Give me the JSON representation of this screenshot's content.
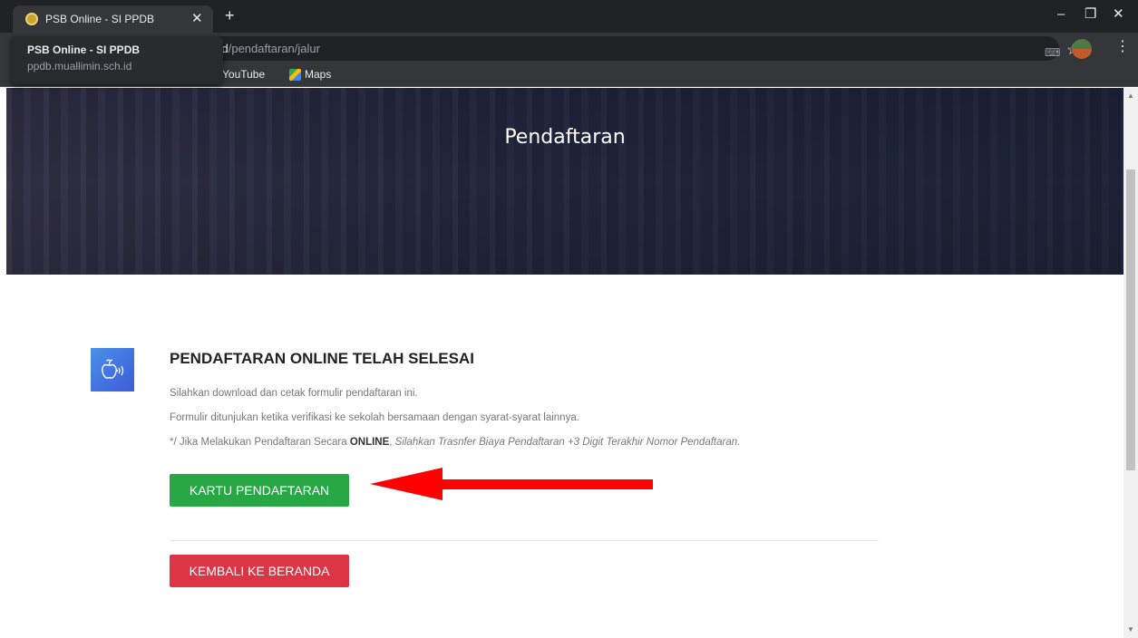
{
  "browser": {
    "tab_title": "PSB Online - SI PPDB",
    "tab_close": "✕",
    "new_tab": "+",
    "url_domain": ".id",
    "url_path": "/pendaftaran/jalur",
    "window_controls": {
      "minimize": "–",
      "restore": "❐",
      "close": "✕"
    },
    "bookmarks": [
      "YouTube",
      "Maps"
    ],
    "hover_card": {
      "title": "PSB Online - SI PPDB",
      "url": "ppdb.muallimin.sch.id"
    },
    "icons": {
      "translate": "translate-icon",
      "star": "star-icon",
      "menu": "menu-icon"
    }
  },
  "hero": {
    "title": "Pendaftaran"
  },
  "main": {
    "heading": "PENDAFTARAN ONLINE TELAH SELESAI",
    "line1": "Silahkan download dan cetak formulir pendaftaran ini.",
    "line2": "Formulir ditunjukan ketika verifikasi ke sekolah bersamaan dengan syarat-syarat lainnya.",
    "line3_prefix": "*/ Jika Melakukan Pendaftaran Secara ",
    "line3_bold": "ONLINE",
    "line3_comma": ", ",
    "line3_italic": "Silahkan Trasnfer Biaya Pendaftaran +3 Digit Terakhir Nomor Pendaftaran.",
    "kartu_button": "KARTU PENDAFTARAN",
    "kembali_button": "KEMBALI KE BERANDA"
  },
  "colors": {
    "green_button": "#28a745",
    "red_button": "#dc3545",
    "annotation_arrow": "#ff0000",
    "icon_gradient_start": "#4a90e8",
    "icon_gradient_end": "#3d5bd9"
  }
}
